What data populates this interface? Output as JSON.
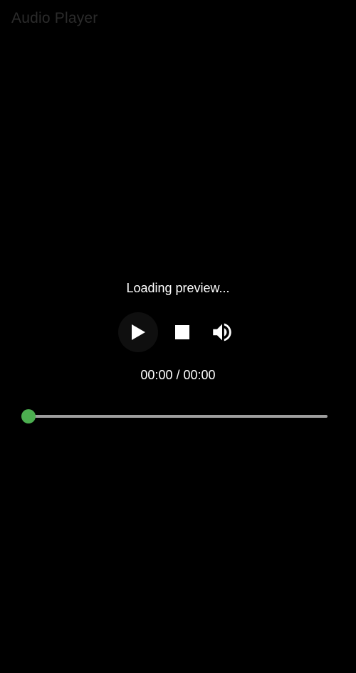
{
  "app": {
    "title": "Audio Player"
  },
  "player": {
    "status": "Loading preview...",
    "current_time": "00:00",
    "separator": "/",
    "duration": "00:00",
    "progress": 0,
    "icons": {
      "play": "play-icon",
      "stop": "stop-icon",
      "volume": "volume-up-icon"
    }
  },
  "colors": {
    "background": "#000000",
    "accent": "#4caf50",
    "track": "#9e9e9e",
    "text": "#ffffff",
    "title": "#2b2b2b"
  }
}
